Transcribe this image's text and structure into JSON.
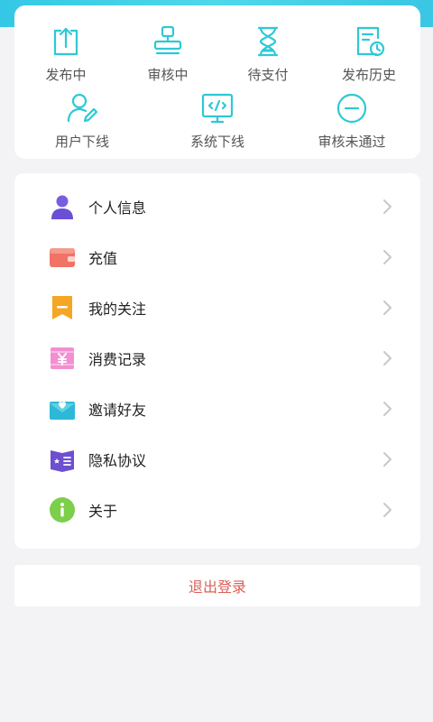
{
  "status_grid": [
    {
      "label": "发布中",
      "icon": "upload-icon"
    },
    {
      "label": "审核中",
      "icon": "stamp-icon"
    },
    {
      "label": "待支付",
      "icon": "hourglass-icon"
    },
    {
      "label": "发布历史",
      "icon": "history-document-icon"
    },
    {
      "label": "用户下线",
      "icon": "user-edit-icon"
    },
    {
      "label": "系统下线",
      "icon": "code-monitor-icon"
    },
    {
      "label": "审核未通过",
      "icon": "minus-circle-icon"
    }
  ],
  "menu": [
    {
      "label": "个人信息",
      "icon": "person-icon"
    },
    {
      "label": "充值",
      "icon": "wallet-icon"
    },
    {
      "label": "我的关注",
      "icon": "bookmark-icon"
    },
    {
      "label": "消费记录",
      "icon": "yuan-ticket-icon"
    },
    {
      "label": "邀请好友",
      "icon": "envelope-heart-icon"
    },
    {
      "label": "隐私协议",
      "icon": "book-icon"
    },
    {
      "label": "关于",
      "icon": "info-icon"
    }
  ],
  "logout": {
    "label": "退出登录"
  },
  "colors": {
    "accent": "#2cc9d6",
    "logout_text": "#d9605a",
    "page_bg": "#f3f3f6"
  }
}
